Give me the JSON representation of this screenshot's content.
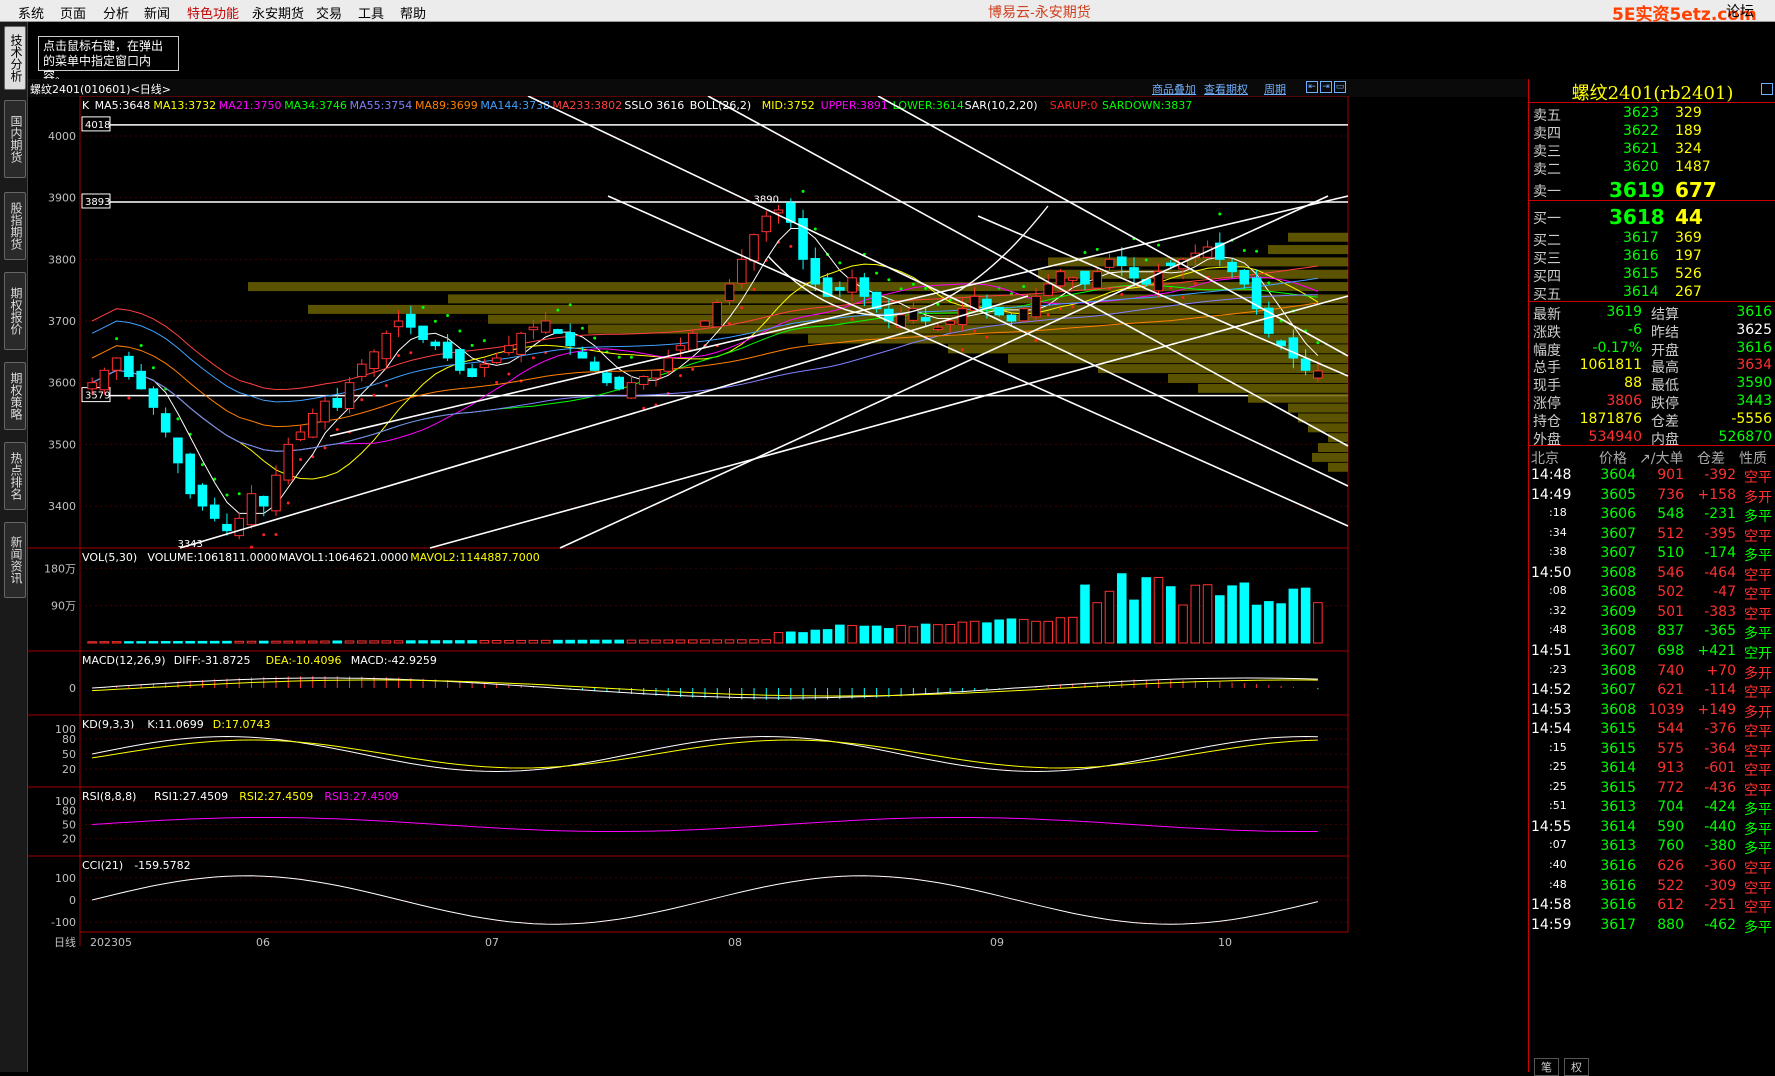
{
  "menu": [
    "系统",
    "页面",
    "分析",
    "新闻",
    "特色功能",
    "永安期货",
    "交易",
    "工具",
    "帮助"
  ],
  "app_title": "博易云-永安期货",
  "watermark": "5E实资5etz.com",
  "forum": "论坛",
  "left_tabs": [
    "技术分析",
    "国内期货",
    "股指期货",
    "期权报价",
    "期权策略",
    "热点排名",
    "新闻资讯"
  ],
  "tip": "点击鼠标右键，在弹出的菜单中指定窗口内容。",
  "chart_header": {
    "symbol": "螺纹2401(010601)<日线>",
    "links": [
      "商品叠加",
      "查看期权",
      "周期"
    ]
  },
  "indicators": {
    "main": [
      {
        "t": "K",
        "c": "#ffffff"
      },
      {
        "t": "MA5:3648",
        "c": "#ffffff"
      },
      {
        "t": "MA13:3732",
        "c": "#ffff00"
      },
      {
        "t": "MA21:3750",
        "c": "#ff00ff"
      },
      {
        "t": "MA34:3746",
        "c": "#00ff00"
      },
      {
        "t": "MA55:3754",
        "c": "#8080ff"
      },
      {
        "t": "MA89:3699",
        "c": "#ff8000"
      },
      {
        "t": "MA144:3738",
        "c": "#40a0ff"
      },
      {
        "t": "MA233:3802",
        "c": "#ff4040"
      },
      {
        "t": "SSLO 3616",
        "c": "#ffffff"
      },
      {
        "t": "BOLL(26,2)",
        "c": "#ffffff"
      },
      {
        "t": "MID:3752",
        "c": "#ffff00"
      },
      {
        "t": "UPPER:3891",
        "c": "#ff00ff"
      },
      {
        "t": "LOWER:3614",
        "c": "#00ff00"
      },
      {
        "t": "SAR(10,2,20)",
        "c": "#ffffff"
      },
      {
        "t": "SARUP:0",
        "c": "#ff2020"
      },
      {
        "t": "SARDOWN:3837",
        "c": "#00ff00"
      }
    ],
    "vol": [
      {
        "t": "VOL(5,30)",
        "c": "#ffffff"
      },
      {
        "t": "VOLUME:1061811.0000",
        "c": "#ffffff"
      },
      {
        "t": "MAVOL1:1064621.0000",
        "c": "#ffffff"
      },
      {
        "t": "MAVOL2:1144887.7000",
        "c": "#ffff00"
      }
    ],
    "macd": [
      {
        "t": "MACD(12,26,9)",
        "c": "#ffffff"
      },
      {
        "t": "DIFF:-31.8725",
        "c": "#ffffff"
      },
      {
        "t": "DEA:-10.4096",
        "c": "#ffff00"
      },
      {
        "t": "MACD:-42.9259",
        "c": "#ffffff"
      }
    ],
    "kd": [
      {
        "t": "KD(9,3,3)",
        "c": "#ffffff"
      },
      {
        "t": "K:11.0699",
        "c": "#ffffff"
      },
      {
        "t": "D:17.0743",
        "c": "#ffff00"
      }
    ],
    "rsi": [
      {
        "t": "RSI(8,8,8)",
        "c": "#ffffff"
      },
      {
        "t": "RSI1:27.4509",
        "c": "#ffffff"
      },
      {
        "t": "RSI2:27.4509",
        "c": "#ffff00"
      },
      {
        "t": "RSI3:27.4509",
        "c": "#ff00ff"
      }
    ],
    "cci": [
      {
        "t": "CCI(21)",
        "c": "#ffffff"
      },
      {
        "t": "-159.5782",
        "c": "#ffffff"
      }
    ]
  },
  "price_axis": [
    "4000",
    "3900",
    "3800",
    "3700",
    "3600",
    "3500",
    "3400"
  ],
  "price_tags": [
    "4018",
    "3893",
    "3579"
  ],
  "chart_annotations": {
    "high": "3890",
    "low": "3343"
  },
  "vol_axis": [
    "180万",
    "90万"
  ],
  "macd_axis": [
    "0"
  ],
  "kd_axis": [
    "100",
    "80",
    "50",
    "20"
  ],
  "rsi_axis": [
    "100",
    "80",
    "50",
    "20"
  ],
  "cci_axis": [
    "100",
    "0",
    "-100"
  ],
  "date_axis": [
    "日线",
    "202305",
    "06",
    "07",
    "08",
    "09",
    "10"
  ],
  "right_panel": {
    "title": "螺纹2401(rb2401)",
    "asks": [
      {
        "label": "卖五",
        "price": "3623",
        "vol": "329"
      },
      {
        "label": "卖四",
        "price": "3622",
        "vol": "189"
      },
      {
        "label": "卖三",
        "price": "3621",
        "vol": "324"
      },
      {
        "label": "卖二",
        "price": "3620",
        "vol": "1487"
      },
      {
        "label": "卖一",
        "price": "3619",
        "vol": "677"
      }
    ],
    "bids": [
      {
        "label": "买一",
        "price": "3618",
        "vol": "44"
      },
      {
        "label": "买二",
        "price": "3617",
        "vol": "369"
      },
      {
        "label": "买三",
        "price": "3616",
        "vol": "197"
      },
      {
        "label": "买四",
        "price": "3615",
        "vol": "526"
      },
      {
        "label": "买五",
        "price": "3614",
        "vol": "267"
      }
    ],
    "quote": [
      {
        "l1": "最新",
        "v1": "3619",
        "c1": "#00ff00",
        "l2": "结算",
        "v2": "3616",
        "c2": "#00ff00"
      },
      {
        "l1": "涨跌",
        "v1": "-6",
        "c1": "#00ff00",
        "l2": "昨结",
        "v2": "3625",
        "c2": "#ffffff"
      },
      {
        "l1": "幅度",
        "v1": "-0.17%",
        "c1": "#00ff00",
        "l2": "开盘",
        "v2": "3616",
        "c2": "#00ff00"
      },
      {
        "l1": "总手",
        "v1": "1061811",
        "c1": "#ffff00",
        "l2": "最高",
        "v2": "3634",
        "c2": "#ff3030"
      },
      {
        "l1": "现手",
        "v1": "88",
        "c1": "#ffff00",
        "l2": "最低",
        "v2": "3590",
        "c2": "#00ff00"
      },
      {
        "l1": "涨停",
        "v1": "3806",
        "c1": "#ff3030",
        "l2": "跌停",
        "v2": "3443",
        "c2": "#00ff00"
      },
      {
        "l1": "持仓",
        "v1": "1871876",
        "c1": "#ffff00",
        "l2": "仓差",
        "v2": "-5556",
        "c2": "#ffff00"
      },
      {
        "l1": "外盘",
        "v1": "534940",
        "c1": "#ff3030",
        "l2": "内盘",
        "v2": "526870",
        "c2": "#00ff00"
      }
    ],
    "tick_header": [
      "北京",
      "价格",
      "↗/大单",
      "仓差",
      "性质"
    ],
    "ticks": [
      {
        "time": "14:48",
        "price": "3604",
        "vol": "901",
        "diff": "-392",
        "nature": "空平",
        "vc": "#ff3030",
        "nc": "#ff3030"
      },
      {
        "time": "14:49",
        "price": "3605",
        "vol": "736",
        "diff": "+158",
        "nature": "多开",
        "vc": "#ff3030",
        "nc": "#ff3030"
      },
      {
        "time": ":18",
        "price": "3606",
        "vol": "548",
        "diff": "-231",
        "nature": "多平",
        "vc": "#00ff00",
        "nc": "#00ff00"
      },
      {
        "time": ":34",
        "price": "3607",
        "vol": "512",
        "diff": "-395",
        "nature": "空平",
        "vc": "#ff3030",
        "nc": "#ff3030"
      },
      {
        "time": ":38",
        "price": "3607",
        "vol": "510",
        "diff": "-174",
        "nature": "多平",
        "vc": "#00ff00",
        "nc": "#00ff00"
      },
      {
        "time": "14:50",
        "price": "3608",
        "vol": "546",
        "diff": "-464",
        "nature": "空平",
        "vc": "#ff3030",
        "nc": "#ff3030"
      },
      {
        "time": ":08",
        "price": "3608",
        "vol": "502",
        "diff": "-47",
        "nature": "空平",
        "vc": "#ff3030",
        "nc": "#ff3030"
      },
      {
        "time": ":32",
        "price": "3609",
        "vol": "501",
        "diff": "-383",
        "nature": "空平",
        "vc": "#ff3030",
        "nc": "#ff3030"
      },
      {
        "time": ":48",
        "price": "3608",
        "vol": "837",
        "diff": "-365",
        "nature": "多平",
        "vc": "#00ff00",
        "nc": "#00ff00"
      },
      {
        "time": "14:51",
        "price": "3607",
        "vol": "698",
        "diff": "+421",
        "nature": "空开",
        "vc": "#00ff00",
        "nc": "#00ff00"
      },
      {
        "time": ":23",
        "price": "3608",
        "vol": "740",
        "diff": "+70",
        "nature": "多开",
        "vc": "#ff3030",
        "nc": "#ff3030"
      },
      {
        "time": "14:52",
        "price": "3607",
        "vol": "621",
        "diff": "-114",
        "nature": "空平",
        "vc": "#ff3030",
        "nc": "#ff3030"
      },
      {
        "time": "14:53",
        "price": "3608",
        "vol": "1039",
        "diff": "+149",
        "nature": "多开",
        "vc": "#ff3030",
        "nc": "#ff3030"
      },
      {
        "time": "14:54",
        "price": "3615",
        "vol": "544",
        "diff": "-376",
        "nature": "空平",
        "vc": "#ff3030",
        "nc": "#ff3030"
      },
      {
        "time": ":15",
        "price": "3615",
        "vol": "575",
        "diff": "-364",
        "nature": "空平",
        "vc": "#ff3030",
        "nc": "#ff3030"
      },
      {
        "time": ":25",
        "price": "3614",
        "vol": "913",
        "diff": "-601",
        "nature": "空平",
        "vc": "#ff3030",
        "nc": "#ff3030"
      },
      {
        "time": ":25",
        "price": "3615",
        "vol": "772",
        "diff": "-436",
        "nature": "空平",
        "vc": "#ff3030",
        "nc": "#ff3030"
      },
      {
        "time": ":51",
        "price": "3613",
        "vol": "704",
        "diff": "-424",
        "nature": "多平",
        "vc": "#00ff00",
        "nc": "#00ff00"
      },
      {
        "time": "14:55",
        "price": "3614",
        "vol": "590",
        "diff": "-440",
        "nature": "多平",
        "vc": "#00ff00",
        "nc": "#00ff00"
      },
      {
        "time": ":07",
        "price": "3613",
        "vol": "760",
        "diff": "-380",
        "nature": "多平",
        "vc": "#00ff00",
        "nc": "#00ff00"
      },
      {
        "time": ":40",
        "price": "3616",
        "vol": "626",
        "diff": "-360",
        "nature": "空平",
        "vc": "#ff3030",
        "nc": "#ff3030"
      },
      {
        "time": ":48",
        "price": "3616",
        "vol": "522",
        "diff": "-309",
        "nature": "空平",
        "vc": "#ff3030",
        "nc": "#ff3030"
      },
      {
        "time": "14:58",
        "price": "3616",
        "vol": "612",
        "diff": "-251",
        "nature": "空平",
        "vc": "#ff3030",
        "nc": "#ff3030"
      },
      {
        "time": "14:59",
        "price": "3617",
        "vol": "880",
        "diff": "-462",
        "nature": "多平",
        "vc": "#00ff00",
        "nc": "#00ff00"
      }
    ],
    "bottom_tabs": [
      "笔",
      "权"
    ]
  }
}
